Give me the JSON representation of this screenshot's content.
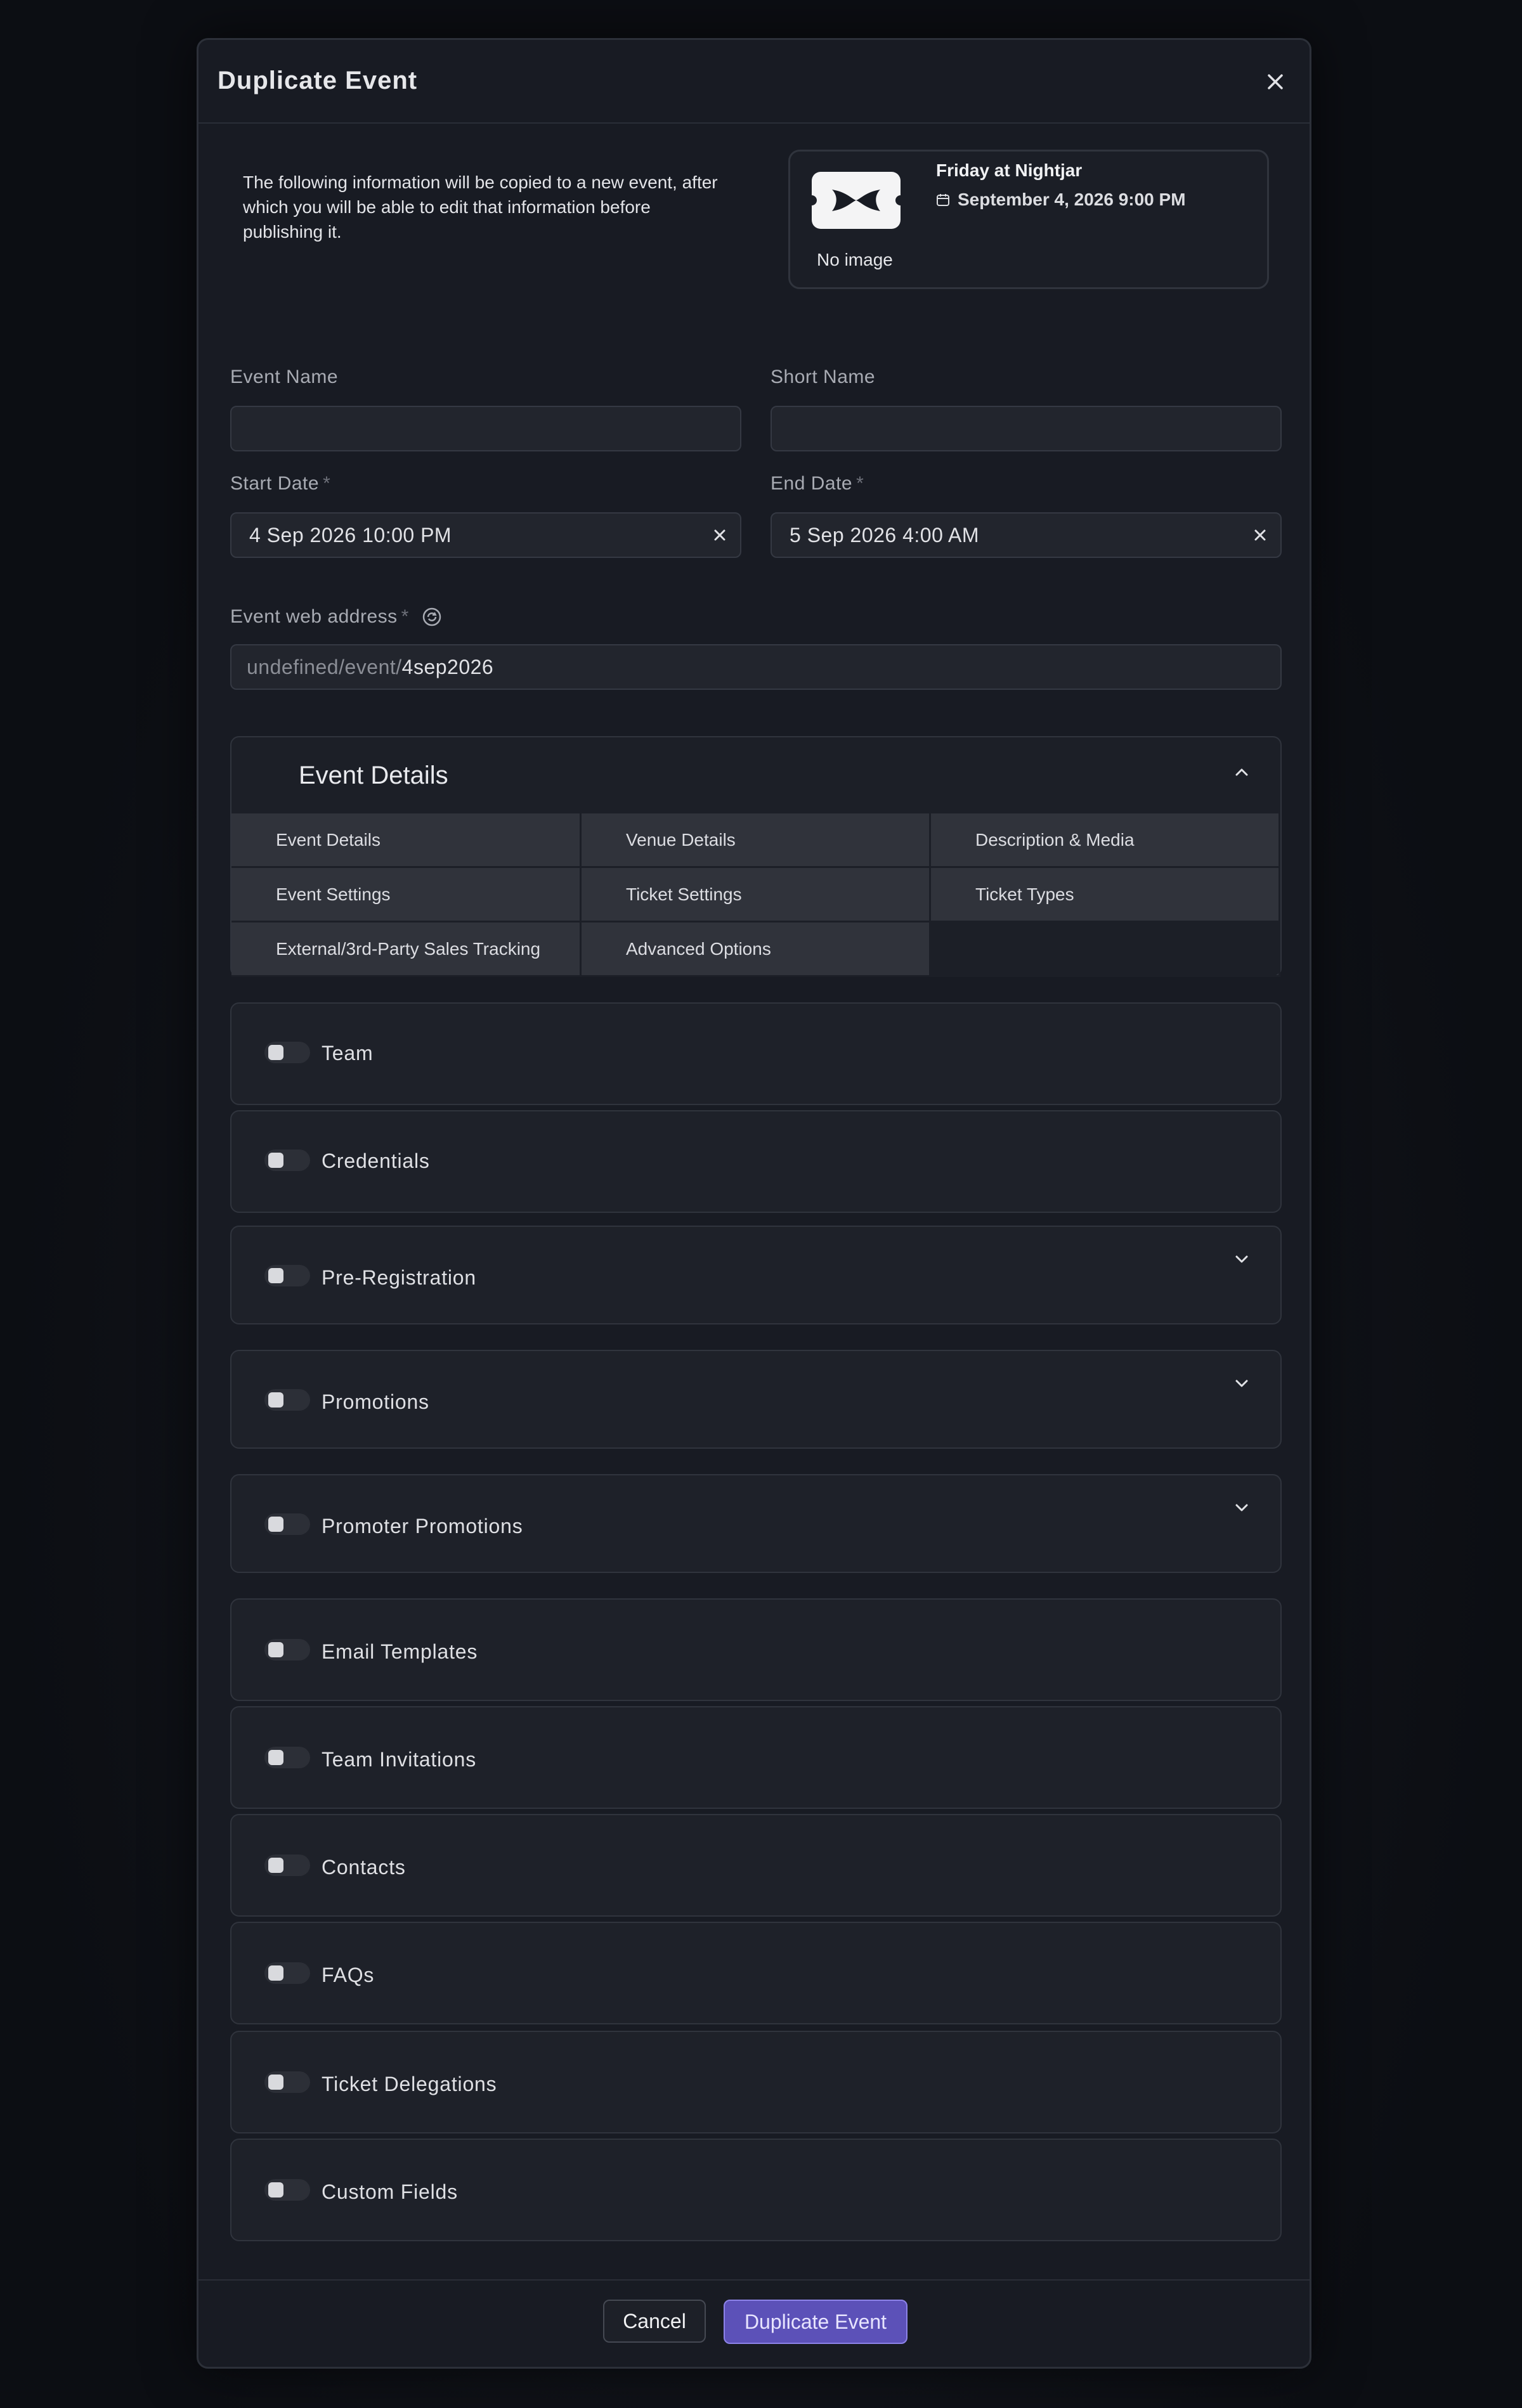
{
  "modal": {
    "title": "Duplicate Event",
    "intro": "The following information will be copied to a new event, after which you will be able to edit that information before publishing it."
  },
  "event_card": {
    "name": "Friday at Nightjar",
    "date": "September 4, 2026 9:00 PM",
    "image_status": "No image"
  },
  "form": {
    "event_name": {
      "label": "Event Name",
      "value": ""
    },
    "short_name": {
      "label": "Short Name",
      "value": ""
    },
    "start_date": {
      "label": "Start Date",
      "required_mark": "*",
      "value": "4 Sep 2026 10:00 PM"
    },
    "end_date": {
      "label": "End Date",
      "required_mark": "*",
      "value": "5 Sep 2026 4:00 AM"
    },
    "web_address": {
      "label": "Event web address",
      "required_mark": "*",
      "prefix": "undefined/event/",
      "slug": "4sep2026"
    }
  },
  "event_details": {
    "title": "Event Details",
    "items": [
      "Event Details",
      "Venue Details",
      "Description & Media",
      "Event Settings",
      "Ticket Settings",
      "Ticket Types",
      "External/3rd-Party Sales Tracking",
      "Advanced Options"
    ]
  },
  "sections": [
    {
      "label": "Team",
      "enabled": false,
      "expandable": false
    },
    {
      "label": "Credentials",
      "enabled": false,
      "expandable": false
    },
    {
      "label": "Pre-Registration",
      "enabled": false,
      "expandable": true
    },
    {
      "label": "Promotions",
      "enabled": false,
      "expandable": true
    },
    {
      "label": "Promoter Promotions",
      "enabled": false,
      "expandable": true
    },
    {
      "label": "Email Templates",
      "enabled": false,
      "expandable": false
    },
    {
      "label": "Team Invitations",
      "enabled": false,
      "expandable": false
    },
    {
      "label": "Contacts",
      "enabled": false,
      "expandable": false
    },
    {
      "label": "FAQs",
      "enabled": false,
      "expandable": false
    },
    {
      "label": "Ticket Delegations",
      "enabled": false,
      "expandable": false
    },
    {
      "label": "Custom Fields",
      "enabled": false,
      "expandable": false
    }
  ],
  "footer": {
    "cancel_label": "Cancel",
    "submit_label": "Duplicate Event"
  },
  "colors": {
    "accent": "#5c51b8",
    "background": "#181b23"
  }
}
